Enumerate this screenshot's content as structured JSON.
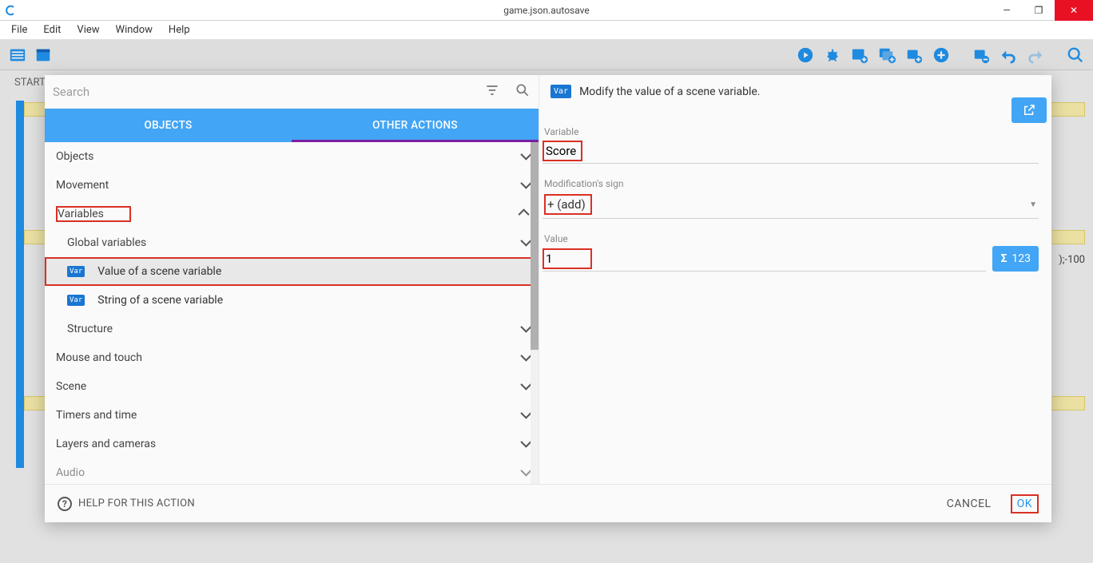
{
  "window": {
    "title": "game.json.autosave"
  },
  "menu": {
    "items": [
      "File",
      "Edit",
      "View",
      "Window",
      "Help"
    ]
  },
  "background": {
    "tab_left": "START"
  },
  "dialog": {
    "search_placeholder": "Search",
    "tabs": {
      "objects": "OBJECTS",
      "other": "OTHER ACTIONS"
    },
    "categories": [
      {
        "label": "Objects",
        "expanded": false,
        "level": 0
      },
      {
        "label": "Movement",
        "expanded": false,
        "level": 0
      },
      {
        "label": "Variables",
        "expanded": true,
        "level": 0,
        "highlight": true
      },
      {
        "label": "Global variables",
        "expanded": false,
        "level": 1
      },
      {
        "label": "Value of a scene variable",
        "leaf": true,
        "level": 1,
        "selected": true,
        "highlight": true,
        "badge": "Var"
      },
      {
        "label": "String of a scene variable",
        "leaf": true,
        "level": 1,
        "badge": "Var"
      },
      {
        "label": "Structure",
        "expanded": false,
        "level": 1
      },
      {
        "label": "Mouse and touch",
        "expanded": false,
        "level": 0
      },
      {
        "label": "Scene",
        "expanded": false,
        "level": 0
      },
      {
        "label": "Timers and time",
        "expanded": false,
        "level": 0
      },
      {
        "label": "Layers and cameras",
        "expanded": false,
        "level": 0
      },
      {
        "label": "Audio",
        "expanded": false,
        "level": 0
      }
    ],
    "right": {
      "badge": "Var",
      "description": "Modify the value of a scene variable.",
      "fields": {
        "variable_label": "Variable",
        "variable_value": "Score",
        "sign_label": "Modification's sign",
        "sign_value": "+ (add)",
        "value_label": "Value",
        "value_value": "1",
        "sigma_label": "123"
      }
    },
    "footer": {
      "help": "HELP FOR THIS ACTION",
      "cancel": "CANCEL",
      "ok": "OK"
    }
  },
  "bg_snippet": ");-100"
}
